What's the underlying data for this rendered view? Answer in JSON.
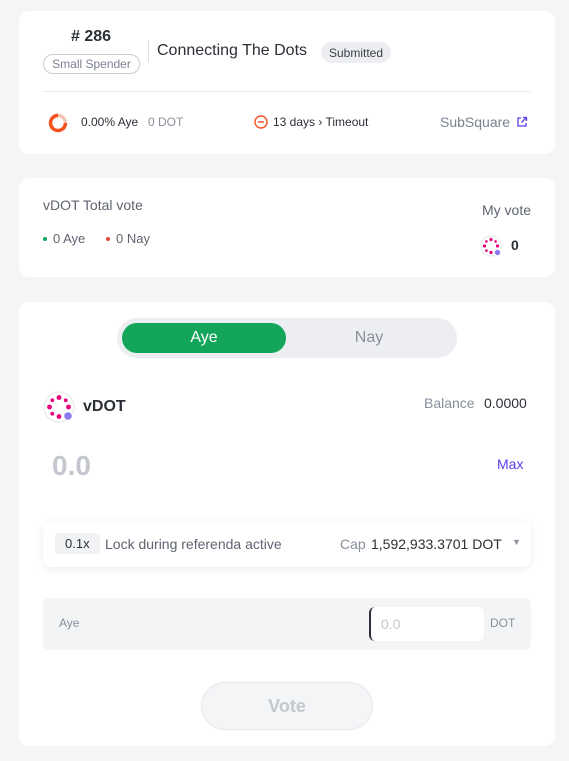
{
  "referendum": {
    "id": "# 286",
    "track": "Small Spender",
    "title": "Connecting The Dots",
    "status": "Submitted",
    "aye_percent": "0.00% Aye",
    "aye_amount": "0 DOT",
    "timeout": "13 days › Timeout",
    "link_label": "SubSquare"
  },
  "votes": {
    "total_label": "vDOT Total vote",
    "aye": "0 Aye",
    "nay": "0 Nay",
    "my_vote_label": "My vote",
    "my_vote_value": "0"
  },
  "form": {
    "toggle": {
      "aye": "Aye",
      "nay": "Nay"
    },
    "token": "vDOT",
    "balance_label": "Balance",
    "balance_value": "0.0000",
    "amount_display": "0.0",
    "max_label": "Max",
    "conviction": "0.1x",
    "lock_text": "Lock during referenda active",
    "cap_label": "Cap",
    "cap_value": "1,592,933.3701 DOT",
    "aye_label": "Aye",
    "aye_placeholder": "0.0",
    "aye_unit": "DOT",
    "vote_button": "Vote"
  },
  "colors": {
    "aye_green": "#13a65a",
    "nay_red": "#e5483d",
    "link_purple": "#5b3cf0",
    "timeout_orange": "#f4511e"
  },
  "icons": {
    "ring": "progress-ring-icon",
    "timeout": "minus-circle-icon",
    "external": "external-link-icon",
    "token": "vdot-token-icon"
  }
}
